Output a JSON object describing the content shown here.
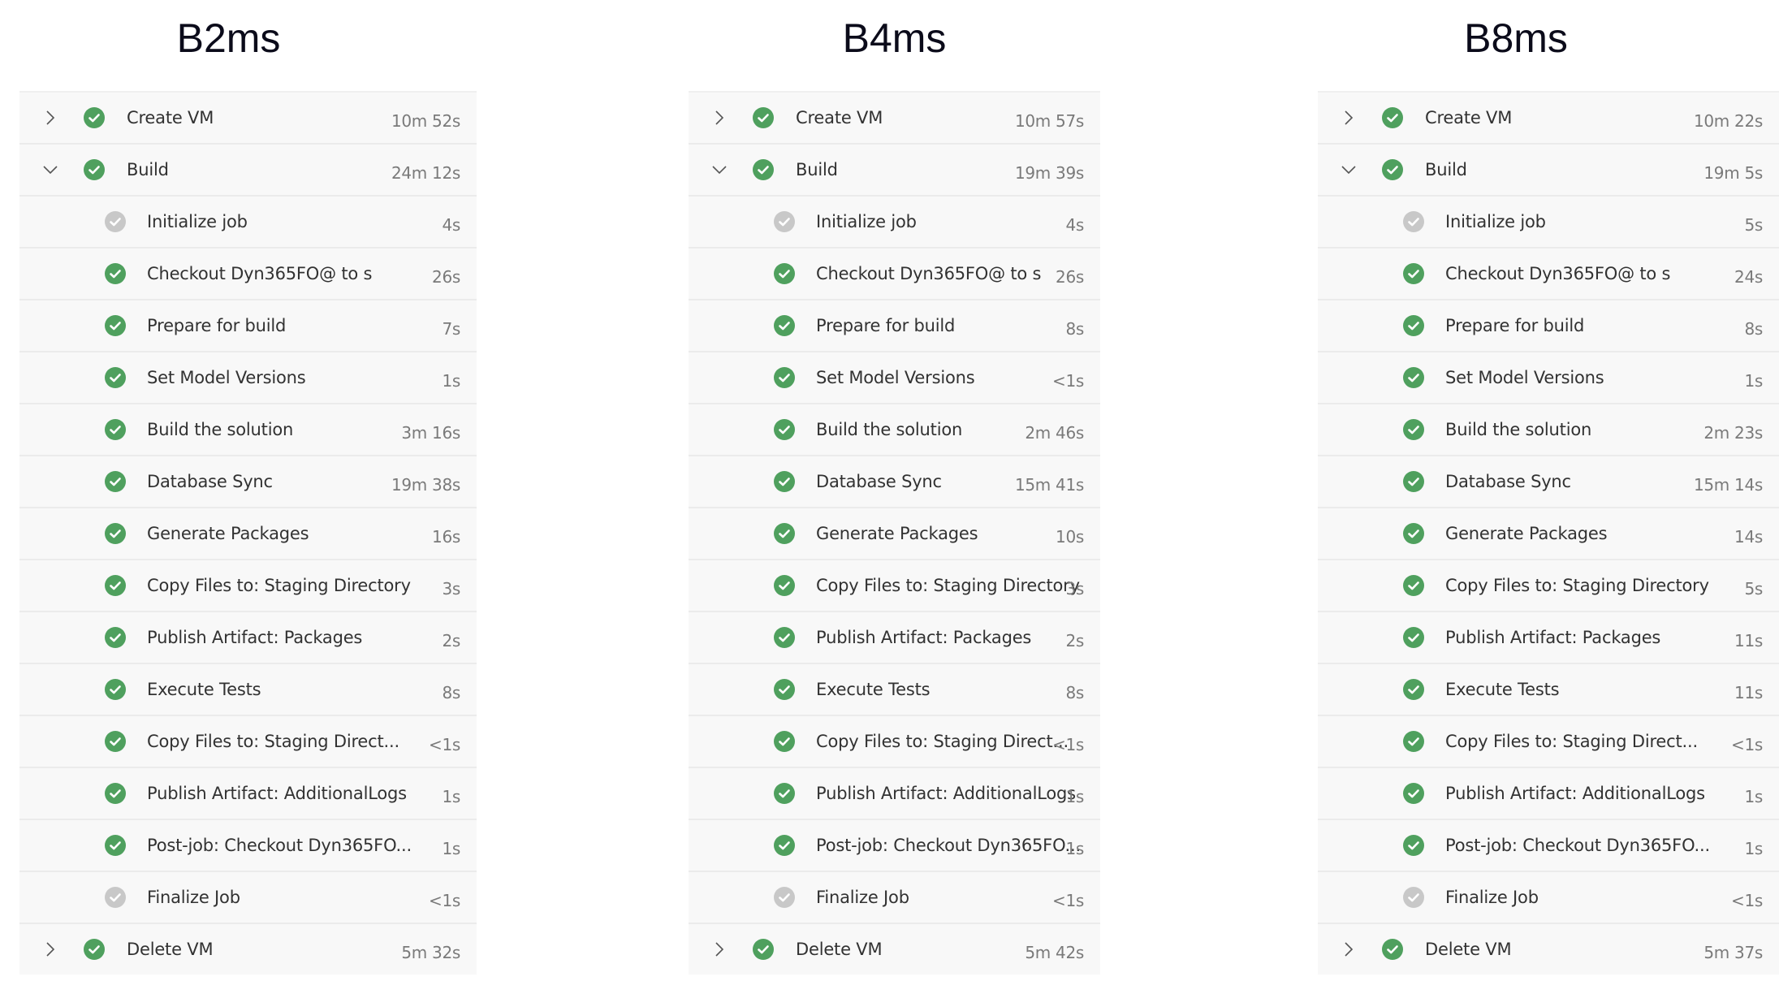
{
  "colors": {
    "success": "#4fa05e",
    "skipped": "#c8c8c8",
    "row_bg": "#f8f8f8",
    "divider": "#ebebeb"
  },
  "panels": [
    {
      "title": "B2ms",
      "rows": [
        {
          "type": "stage",
          "expand": "collapsed",
          "status": "success",
          "label": "Create VM",
          "time": "10m 52s"
        },
        {
          "type": "stage",
          "expand": "expanded",
          "status": "success",
          "label": "Build",
          "time": "24m 12s"
        },
        {
          "type": "step",
          "status": "skipped",
          "label": "Initialize job",
          "time": "4s"
        },
        {
          "type": "step",
          "status": "success",
          "label": "Checkout Dyn365FO@ to s",
          "time": "26s"
        },
        {
          "type": "step",
          "status": "success",
          "label": "Prepare for build",
          "time": "7s"
        },
        {
          "type": "step",
          "status": "success",
          "label": "Set Model Versions",
          "time": "1s"
        },
        {
          "type": "step",
          "status": "success",
          "label": "Build the solution",
          "time": "3m 16s"
        },
        {
          "type": "step",
          "status": "success",
          "label": "Database Sync",
          "time": "19m 38s"
        },
        {
          "type": "step",
          "status": "success",
          "label": "Generate Packages",
          "time": "16s"
        },
        {
          "type": "step",
          "status": "success",
          "label": "Copy Files to: Staging Directory",
          "time": "3s"
        },
        {
          "type": "step",
          "status": "success",
          "label": "Publish Artifact: Packages",
          "time": "2s"
        },
        {
          "type": "step",
          "status": "success",
          "label": "Execute Tests",
          "time": "8s"
        },
        {
          "type": "step",
          "status": "success",
          "label": "Copy Files to: Staging Direct...",
          "time": "<1s"
        },
        {
          "type": "step",
          "status": "success",
          "label": "Publish Artifact: AdditionalLogs",
          "time": "1s"
        },
        {
          "type": "step",
          "status": "success",
          "label": "Post-job: Checkout Dyn365FO...",
          "time": "1s"
        },
        {
          "type": "step",
          "status": "skipped",
          "label": "Finalize Job",
          "time": "<1s"
        },
        {
          "type": "stage",
          "expand": "collapsed",
          "status": "success",
          "label": "Delete VM",
          "time": "5m 32s"
        }
      ]
    },
    {
      "title": "B4ms",
      "rows": [
        {
          "type": "stage",
          "expand": "collapsed",
          "status": "success",
          "label": "Create VM",
          "time": "10m 57s"
        },
        {
          "type": "stage",
          "expand": "expanded",
          "status": "success",
          "label": "Build",
          "time": "19m 39s"
        },
        {
          "type": "step",
          "status": "skipped",
          "label": "Initialize job",
          "time": "4s"
        },
        {
          "type": "step",
          "status": "success",
          "label": "Checkout Dyn365FO@ to s",
          "time": "26s"
        },
        {
          "type": "step",
          "status": "success",
          "label": "Prepare for build",
          "time": "8s"
        },
        {
          "type": "step",
          "status": "success",
          "label": "Set Model Versions",
          "time": "<1s"
        },
        {
          "type": "step",
          "status": "success",
          "label": "Build the solution",
          "time": "2m 46s"
        },
        {
          "type": "step",
          "status": "success",
          "label": "Database Sync",
          "time": "15m 41s"
        },
        {
          "type": "step",
          "status": "success",
          "label": "Generate Packages",
          "time": "10s"
        },
        {
          "type": "step",
          "status": "success",
          "label": "Copy Files to: Staging Directory",
          "time": "3s"
        },
        {
          "type": "step",
          "status": "success",
          "label": "Publish Artifact: Packages",
          "time": "2s"
        },
        {
          "type": "step",
          "status": "success",
          "label": "Execute Tests",
          "time": "8s"
        },
        {
          "type": "step",
          "status": "success",
          "label": "Copy Files to: Staging Direct...",
          "time": "<1s"
        },
        {
          "type": "step",
          "status": "success",
          "label": "Publish Artifact: AdditionalLogs",
          "time": "1s"
        },
        {
          "type": "step",
          "status": "success",
          "label": "Post-job: Checkout Dyn365FO...",
          "time": "1s"
        },
        {
          "type": "step",
          "status": "skipped",
          "label": "Finalize Job",
          "time": "<1s"
        },
        {
          "type": "stage",
          "expand": "collapsed",
          "status": "success",
          "label": "Delete VM",
          "time": "5m 42s"
        }
      ]
    },
    {
      "title": "B8ms",
      "rows": [
        {
          "type": "stage",
          "expand": "collapsed",
          "status": "success",
          "label": "Create VM",
          "time": "10m 22s"
        },
        {
          "type": "stage",
          "expand": "expanded",
          "status": "success",
          "label": "Build",
          "time": "19m 5s"
        },
        {
          "type": "step",
          "status": "skipped",
          "label": "Initialize job",
          "time": "5s"
        },
        {
          "type": "step",
          "status": "success",
          "label": "Checkout Dyn365FO@ to s",
          "time": "24s"
        },
        {
          "type": "step",
          "status": "success",
          "label": "Prepare for build",
          "time": "8s"
        },
        {
          "type": "step",
          "status": "success",
          "label": "Set Model Versions",
          "time": "1s"
        },
        {
          "type": "step",
          "status": "success",
          "label": "Build the solution",
          "time": "2m 23s"
        },
        {
          "type": "step",
          "status": "success",
          "label": "Database Sync",
          "time": "15m 14s"
        },
        {
          "type": "step",
          "status": "success",
          "label": "Generate Packages",
          "time": "14s"
        },
        {
          "type": "step",
          "status": "success",
          "label": "Copy Files to: Staging Directory",
          "time": "5s"
        },
        {
          "type": "step",
          "status": "success",
          "label": "Publish Artifact: Packages",
          "time": "11s"
        },
        {
          "type": "step",
          "status": "success",
          "label": "Execute Tests",
          "time": "11s"
        },
        {
          "type": "step",
          "status": "success",
          "label": "Copy Files to: Staging Direct...",
          "time": "<1s"
        },
        {
          "type": "step",
          "status": "success",
          "label": "Publish Artifact: AdditionalLogs",
          "time": "1s"
        },
        {
          "type": "step",
          "status": "success",
          "label": "Post-job: Checkout Dyn365FO...",
          "time": "1s"
        },
        {
          "type": "step",
          "status": "skipped",
          "label": "Finalize Job",
          "time": "<1s"
        },
        {
          "type": "stage",
          "expand": "collapsed",
          "status": "success",
          "label": "Delete VM",
          "time": "5m 37s"
        }
      ]
    }
  ]
}
